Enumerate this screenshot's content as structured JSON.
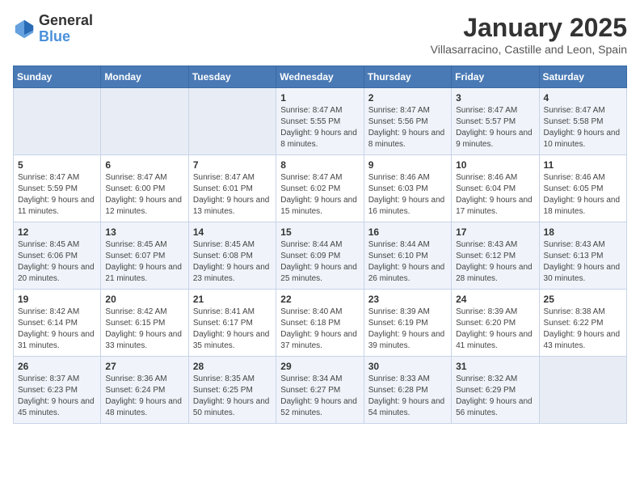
{
  "logo": {
    "general": "General",
    "blue": "Blue"
  },
  "header": {
    "title": "January 2025",
    "subtitle": "Villasarracino, Castille and Leon, Spain"
  },
  "weekdays": [
    "Sunday",
    "Monday",
    "Tuesday",
    "Wednesday",
    "Thursday",
    "Friday",
    "Saturday"
  ],
  "weeks": [
    [
      {
        "day": "",
        "info": ""
      },
      {
        "day": "",
        "info": ""
      },
      {
        "day": "",
        "info": ""
      },
      {
        "day": "1",
        "info": "Sunrise: 8:47 AM\nSunset: 5:55 PM\nDaylight: 9 hours and 8 minutes."
      },
      {
        "day": "2",
        "info": "Sunrise: 8:47 AM\nSunset: 5:56 PM\nDaylight: 9 hours and 8 minutes."
      },
      {
        "day": "3",
        "info": "Sunrise: 8:47 AM\nSunset: 5:57 PM\nDaylight: 9 hours and 9 minutes."
      },
      {
        "day": "4",
        "info": "Sunrise: 8:47 AM\nSunset: 5:58 PM\nDaylight: 9 hours and 10 minutes."
      }
    ],
    [
      {
        "day": "5",
        "info": "Sunrise: 8:47 AM\nSunset: 5:59 PM\nDaylight: 9 hours and 11 minutes."
      },
      {
        "day": "6",
        "info": "Sunrise: 8:47 AM\nSunset: 6:00 PM\nDaylight: 9 hours and 12 minutes."
      },
      {
        "day": "7",
        "info": "Sunrise: 8:47 AM\nSunset: 6:01 PM\nDaylight: 9 hours and 13 minutes."
      },
      {
        "day": "8",
        "info": "Sunrise: 8:47 AM\nSunset: 6:02 PM\nDaylight: 9 hours and 15 minutes."
      },
      {
        "day": "9",
        "info": "Sunrise: 8:46 AM\nSunset: 6:03 PM\nDaylight: 9 hours and 16 minutes."
      },
      {
        "day": "10",
        "info": "Sunrise: 8:46 AM\nSunset: 6:04 PM\nDaylight: 9 hours and 17 minutes."
      },
      {
        "day": "11",
        "info": "Sunrise: 8:46 AM\nSunset: 6:05 PM\nDaylight: 9 hours and 18 minutes."
      }
    ],
    [
      {
        "day": "12",
        "info": "Sunrise: 8:45 AM\nSunset: 6:06 PM\nDaylight: 9 hours and 20 minutes."
      },
      {
        "day": "13",
        "info": "Sunrise: 8:45 AM\nSunset: 6:07 PM\nDaylight: 9 hours and 21 minutes."
      },
      {
        "day": "14",
        "info": "Sunrise: 8:45 AM\nSunset: 6:08 PM\nDaylight: 9 hours and 23 minutes."
      },
      {
        "day": "15",
        "info": "Sunrise: 8:44 AM\nSunset: 6:09 PM\nDaylight: 9 hours and 25 minutes."
      },
      {
        "day": "16",
        "info": "Sunrise: 8:44 AM\nSunset: 6:10 PM\nDaylight: 9 hours and 26 minutes."
      },
      {
        "day": "17",
        "info": "Sunrise: 8:43 AM\nSunset: 6:12 PM\nDaylight: 9 hours and 28 minutes."
      },
      {
        "day": "18",
        "info": "Sunrise: 8:43 AM\nSunset: 6:13 PM\nDaylight: 9 hours and 30 minutes."
      }
    ],
    [
      {
        "day": "19",
        "info": "Sunrise: 8:42 AM\nSunset: 6:14 PM\nDaylight: 9 hours and 31 minutes."
      },
      {
        "day": "20",
        "info": "Sunrise: 8:42 AM\nSunset: 6:15 PM\nDaylight: 9 hours and 33 minutes."
      },
      {
        "day": "21",
        "info": "Sunrise: 8:41 AM\nSunset: 6:17 PM\nDaylight: 9 hours and 35 minutes."
      },
      {
        "day": "22",
        "info": "Sunrise: 8:40 AM\nSunset: 6:18 PM\nDaylight: 9 hours and 37 minutes."
      },
      {
        "day": "23",
        "info": "Sunrise: 8:39 AM\nSunset: 6:19 PM\nDaylight: 9 hours and 39 minutes."
      },
      {
        "day": "24",
        "info": "Sunrise: 8:39 AM\nSunset: 6:20 PM\nDaylight: 9 hours and 41 minutes."
      },
      {
        "day": "25",
        "info": "Sunrise: 8:38 AM\nSunset: 6:22 PM\nDaylight: 9 hours and 43 minutes."
      }
    ],
    [
      {
        "day": "26",
        "info": "Sunrise: 8:37 AM\nSunset: 6:23 PM\nDaylight: 9 hours and 45 minutes."
      },
      {
        "day": "27",
        "info": "Sunrise: 8:36 AM\nSunset: 6:24 PM\nDaylight: 9 hours and 48 minutes."
      },
      {
        "day": "28",
        "info": "Sunrise: 8:35 AM\nSunset: 6:25 PM\nDaylight: 9 hours and 50 minutes."
      },
      {
        "day": "29",
        "info": "Sunrise: 8:34 AM\nSunset: 6:27 PM\nDaylight: 9 hours and 52 minutes."
      },
      {
        "day": "30",
        "info": "Sunrise: 8:33 AM\nSunset: 6:28 PM\nDaylight: 9 hours and 54 minutes."
      },
      {
        "day": "31",
        "info": "Sunrise: 8:32 AM\nSunset: 6:29 PM\nDaylight: 9 hours and 56 minutes."
      },
      {
        "day": "",
        "info": ""
      }
    ]
  ]
}
